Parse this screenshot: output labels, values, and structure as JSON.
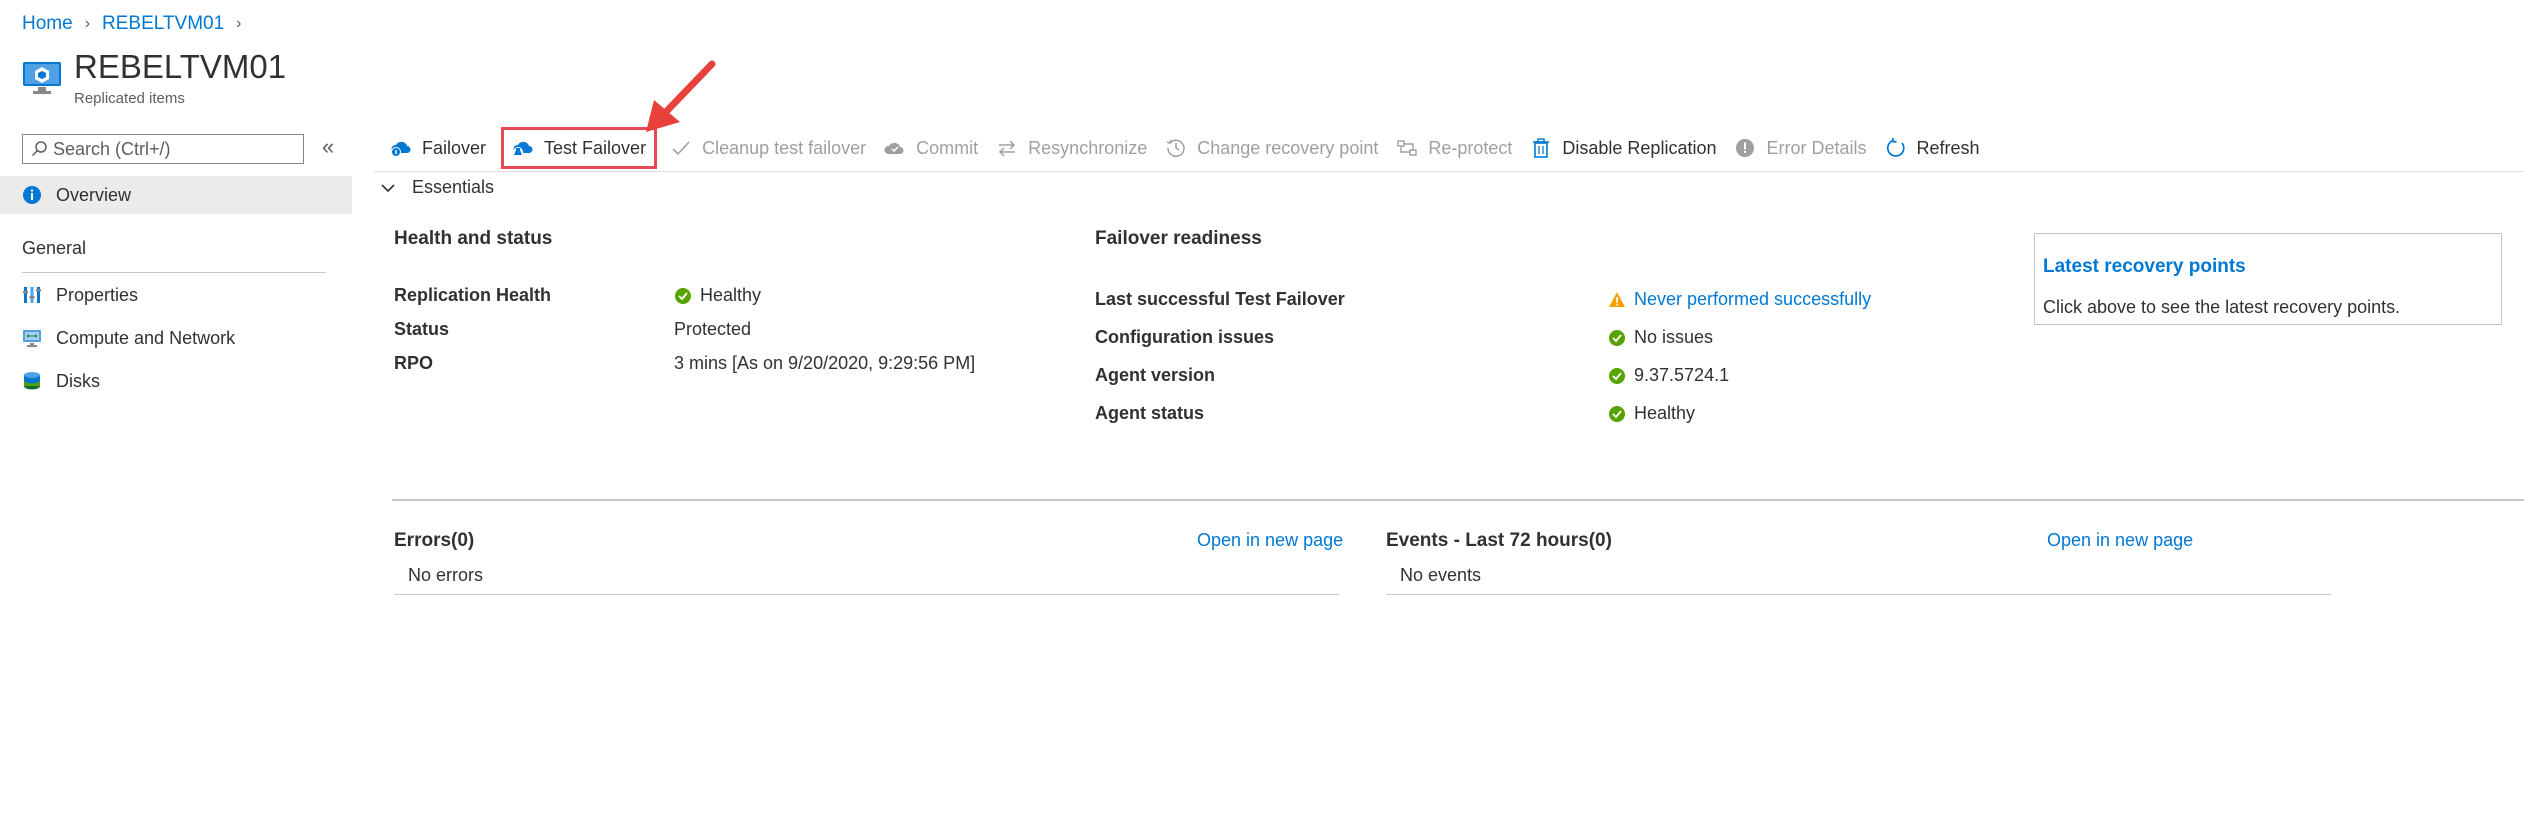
{
  "breadcrumb": {
    "items": [
      {
        "label": "Home"
      },
      {
        "label": "REBELTVM01"
      }
    ]
  },
  "page": {
    "title": "REBELTVM01",
    "subtitle": "Replicated items"
  },
  "sidebar": {
    "search_placeholder": "Search (Ctrl+/)",
    "overview_label": "Overview",
    "group_label": "General",
    "items": [
      {
        "label": "Properties",
        "icon": "properties-icon"
      },
      {
        "label": "Compute and Network",
        "icon": "network-icon"
      },
      {
        "label": "Disks",
        "icon": "disks-icon"
      }
    ]
  },
  "toolbar": {
    "failover": "Failover",
    "test_failover": "Test Failover",
    "cleanup": "Cleanup test failover",
    "commit": "Commit",
    "resync": "Resynchronize",
    "change_rp": "Change recovery point",
    "reprotect": "Re-protect",
    "disable": "Disable Replication",
    "error_details": "Error Details",
    "refresh": "Refresh"
  },
  "essentials": {
    "label": "Essentials"
  },
  "health": {
    "heading": "Health and status",
    "rows": [
      {
        "label": "Replication Health",
        "value": "Healthy"
      },
      {
        "label": "Status",
        "value": "Protected"
      },
      {
        "label": "RPO",
        "value": "3 mins [As on 9/20/2020, 9:29:56 PM]"
      }
    ]
  },
  "failover": {
    "heading": "Failover readiness",
    "rows": [
      {
        "label": "Last successful Test Failover",
        "value": "Never performed successfully"
      },
      {
        "label": "Configuration issues",
        "value": "No issues"
      },
      {
        "label": "Agent version",
        "value": "9.37.5724.1"
      },
      {
        "label": "Agent status",
        "value": "Healthy"
      }
    ]
  },
  "recovery": {
    "title": "Latest recovery points",
    "desc": "Click above to see the latest recovery points."
  },
  "errors": {
    "heading": "Errors(0)",
    "link": "Open in new page",
    "empty": "No errors"
  },
  "events": {
    "heading": "Events - Last 72 hours(0)",
    "link": "Open in new page",
    "empty": "No events"
  },
  "colors": {
    "accent": "#0078d4",
    "success": "#57a300",
    "warning": "#f7a000",
    "highlight": "#e74856"
  }
}
